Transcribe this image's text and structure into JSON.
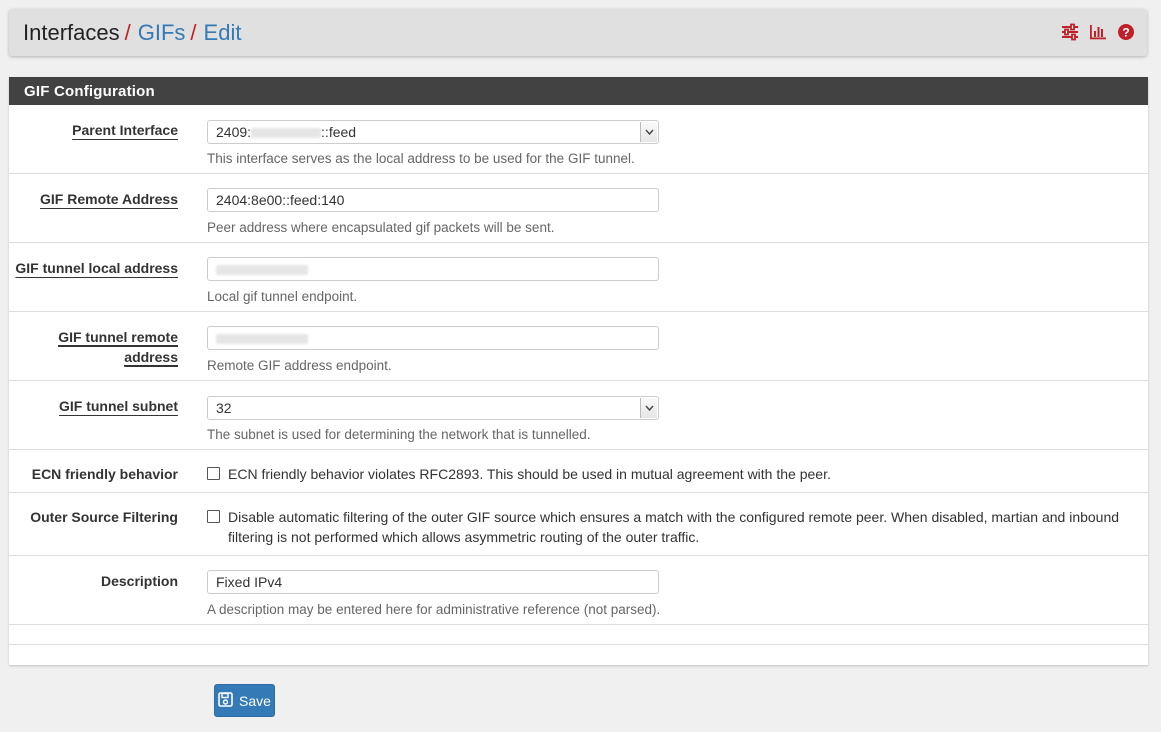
{
  "breadcrumb": {
    "root": "Interfaces",
    "section": "GIFs",
    "page": "Edit",
    "separator": "/"
  },
  "header_icons": [
    "sliders-icon",
    "bar-chart-icon",
    "help-icon"
  ],
  "colors": {
    "accent": "#c12028",
    "link": "#337ab7",
    "panel_heading": "#424242",
    "button": "#337ab7"
  },
  "panel": {
    "title": "GIF Configuration"
  },
  "form": {
    "parent_interface": {
      "label": "Parent Interface",
      "value_prefix": "2409:",
      "value_suffix": "::feed",
      "help": "This interface serves as the local address to be used for the GIF tunnel."
    },
    "remote_address": {
      "label": "GIF Remote Address",
      "value": "2404:8e00::feed:140",
      "help": "Peer address where encapsulated gif packets will be sent."
    },
    "tunnel_local": {
      "label": "GIF tunnel local address",
      "help": "Local gif tunnel endpoint."
    },
    "tunnel_remote": {
      "label_line1": "GIF tunnel remote",
      "label_line2": "address",
      "help": "Remote GIF address endpoint."
    },
    "tunnel_subnet": {
      "label": "GIF tunnel subnet",
      "value": "32",
      "help": "The subnet is used for determining the network that is tunnelled."
    },
    "ecn": {
      "label": "ECN friendly behavior",
      "text": "ECN friendly behavior violates RFC2893. This should be used in mutual agreement with the peer.",
      "checked": false
    },
    "outer_filter": {
      "label": "Outer Source Filtering",
      "text_line1": "Disable automatic filtering of the outer GIF source which ensures a match with the configured remote peer. When disabled, martian and inbound",
      "text_line2": "filtering is not performed which allows asymmetric routing of the outer traffic.",
      "checked": false
    },
    "description": {
      "label": "Description",
      "value": "Fixed IPv4",
      "help": "A description may be entered here for administrative reference (not parsed)."
    }
  },
  "save_button": {
    "label": "Save",
    "icon": "save-icon"
  }
}
